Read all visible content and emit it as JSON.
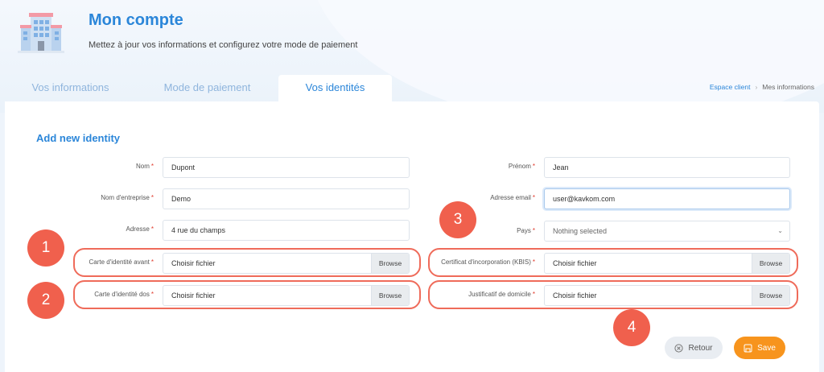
{
  "header": {
    "title": "Mon compte",
    "subtitle": "Mettez à jour vos informations et configurez votre mode de paiement",
    "icon": "building-icon"
  },
  "tabs": [
    {
      "label": "Vos informations",
      "active": false
    },
    {
      "label": "Mode de paiement",
      "active": false
    },
    {
      "label": "Vos identités",
      "active": true
    }
  ],
  "breadcrumb": {
    "link": "Espace client",
    "separator": "›",
    "current": "Mes informations"
  },
  "form": {
    "title": "Add new identity",
    "required_marker": "*",
    "nom": {
      "label": "Nom",
      "value": "Dupont"
    },
    "prenom": {
      "label": "Prénom",
      "value": "Jean"
    },
    "entreprise": {
      "label": "Nom d'entreprise",
      "value": "Demo"
    },
    "email": {
      "label": "Adresse email",
      "value": "user@kavkom.com"
    },
    "adresse": {
      "label": "Adresse",
      "value": "4 rue du champs"
    },
    "pays": {
      "label": "Pays",
      "value": "Nothing selected"
    },
    "cni_avant": {
      "label": "Carte d'identité avant",
      "value": "Choisir fichier",
      "button": "Browse"
    },
    "cni_dos": {
      "label": "Carte d'identité dos",
      "value": "Choisir fichier",
      "button": "Browse"
    },
    "kbis": {
      "label": "Certificat d'incorporation (KBIS)",
      "value": "Choisir fichier",
      "button": "Browse"
    },
    "domicile": {
      "label": "Justificatif de domicile",
      "value": "Choisir fichier",
      "button": "Browse"
    }
  },
  "actions": {
    "retour": "Retour",
    "save": "Save"
  },
  "annotations": [
    "1",
    "2",
    "3",
    "4"
  ],
  "colors": {
    "accent": "#2b86d9",
    "highlight": "#ef6b5a",
    "badge": "#f0604d",
    "save": "#f7941d",
    "required": "#e0392b"
  }
}
